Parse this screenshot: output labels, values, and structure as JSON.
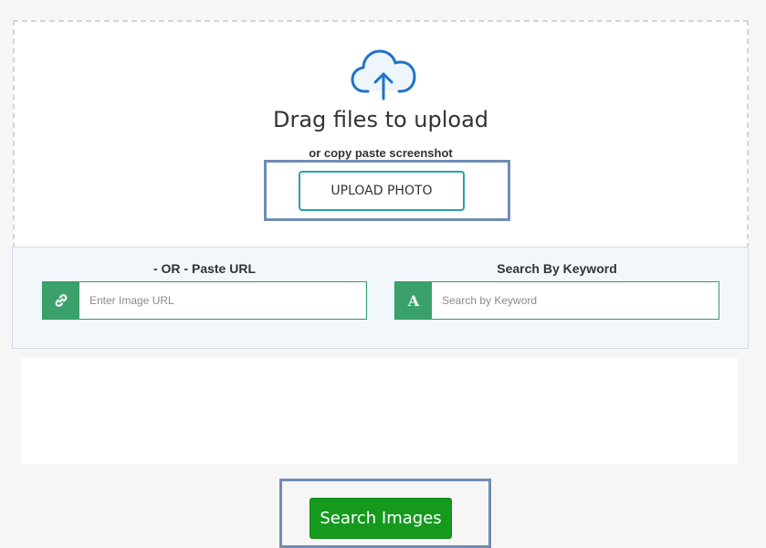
{
  "drop_zone": {
    "icon": "cloud-upload-icon",
    "title": "Drag files to upload",
    "subtitle": "or copy paste screenshot",
    "upload_button_label": "UPLOAD PHOTO"
  },
  "url_search": {
    "label": "- OR - Paste URL",
    "icon": "link-icon",
    "placeholder": "Enter Image URL"
  },
  "keyword_search": {
    "label": "Search By Keyword",
    "icon": "letter-a-icon",
    "icon_text": "A",
    "placeholder": "Search by Keyword"
  },
  "search_button_label": "Search Images",
  "colors": {
    "accent_teal": "#2aa3a0",
    "addon_green": "#3aa16a",
    "search_green": "#159a1e",
    "icon_blue": "#1e73c8",
    "highlight_frame": "#6f8db5"
  }
}
